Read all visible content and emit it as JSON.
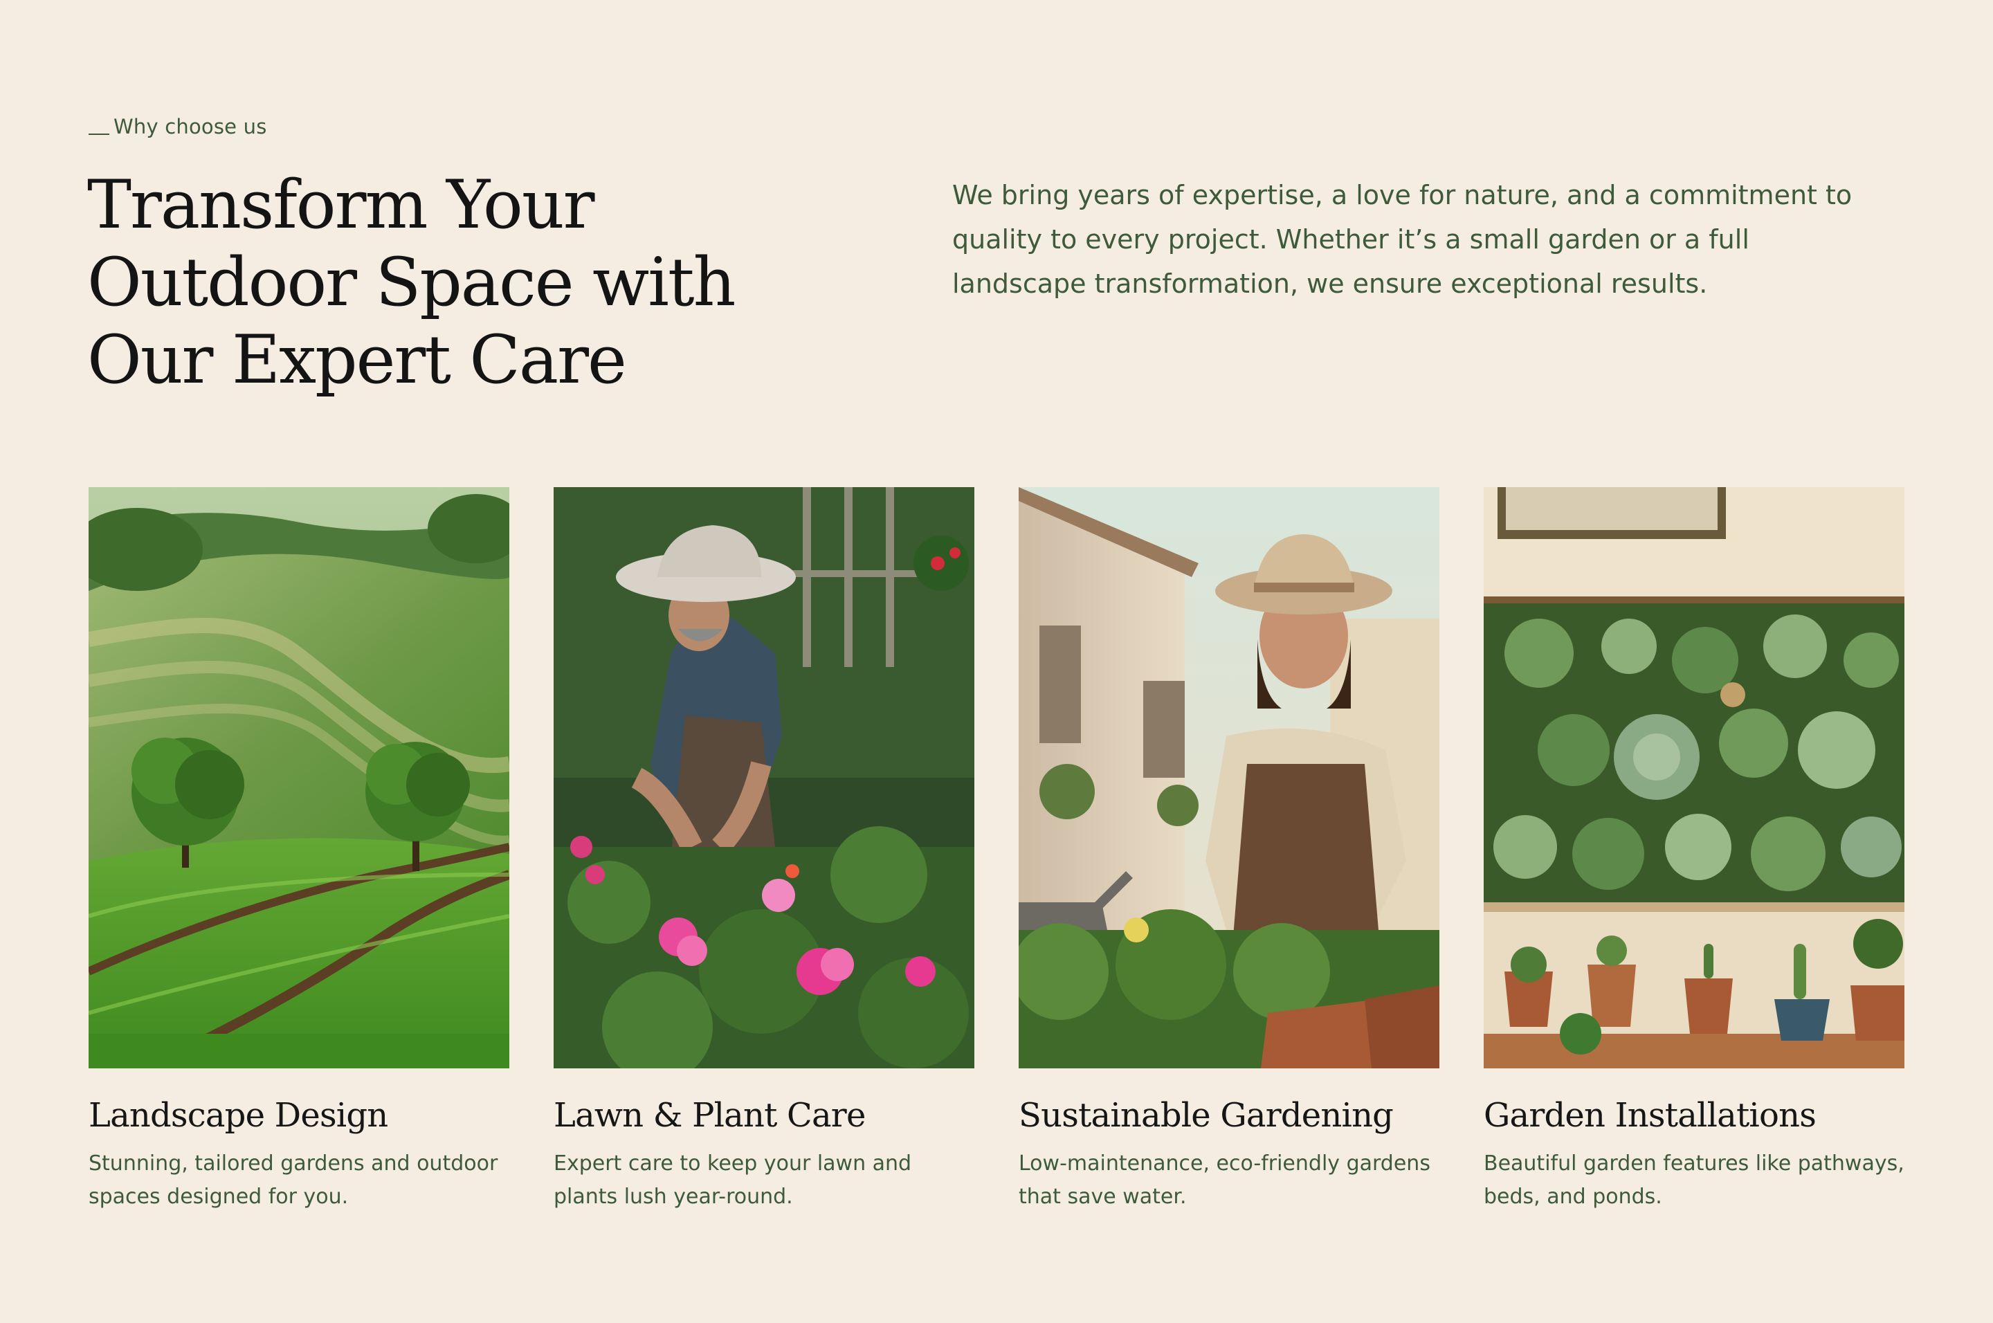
{
  "section": {
    "eyebrow": "Why choose us",
    "headline": [
      "Transform Your",
      "Outdoor Space with",
      "Our Expert Care"
    ],
    "intro": "We bring years of expertise, a love for nature, and a commitment to quality to every project. Whether it’s a small garden or a full landscape transformation, we ensure exceptional results."
  },
  "services": [
    {
      "title": "Landscape Design",
      "description": "Stunning, tailored gardens and outdoor spaces designed for you.",
      "image": "rolling-green-fields-with-trees"
    },
    {
      "title": "Lawn & Plant Care",
      "description": "Expert care to keep your lawn and plants lush year-round.",
      "image": "gardener-tending-flowers"
    },
    {
      "title": "Sustainable Gardening",
      "description": "Low-maintenance, eco-friendly gardens that save water.",
      "image": "woman-with-watering-can"
    },
    {
      "title": "Garden Installations",
      "description": "Beautiful garden features like pathways, beds, and ponds.",
      "image": "succulent-wall-installation"
    }
  ],
  "colors": {
    "background": "#f5ede2",
    "accent_green": "#3d5a3a",
    "heading": "#141414"
  }
}
